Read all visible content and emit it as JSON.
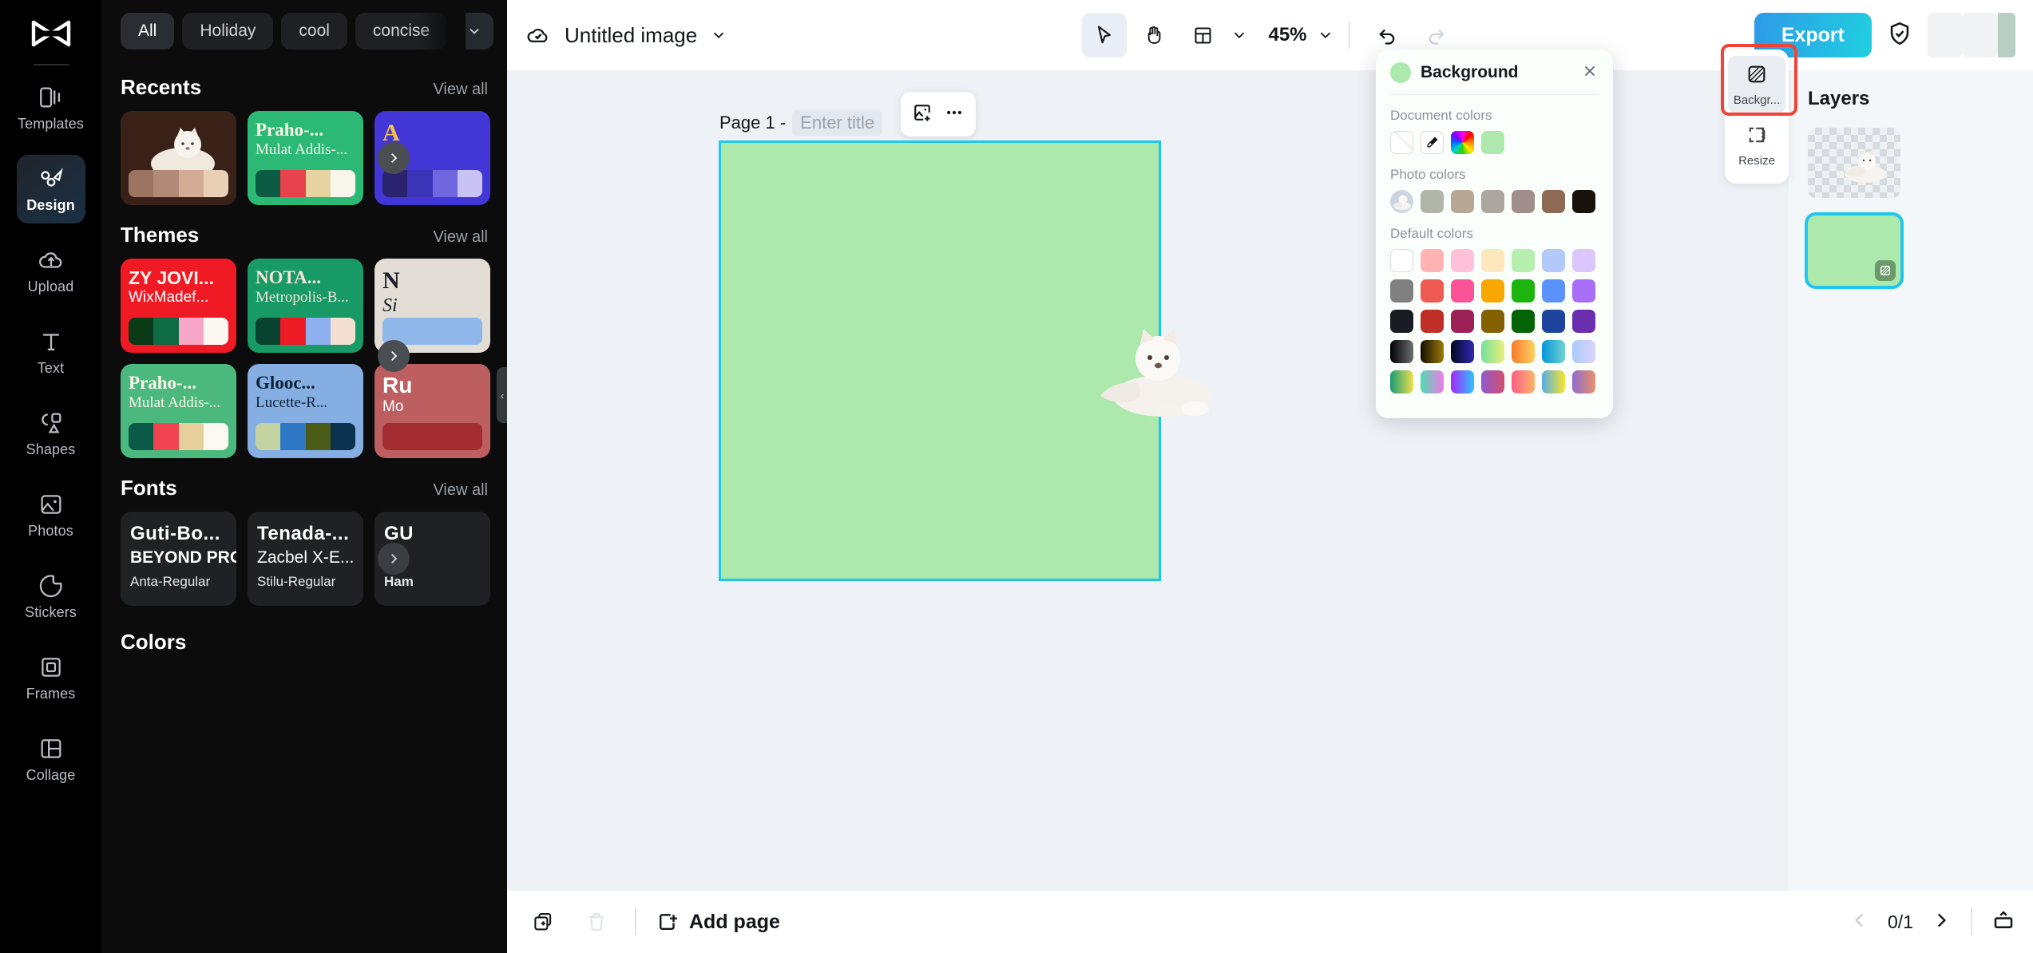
{
  "rail": {
    "logo_icon": "capcut-logo-icon",
    "items": [
      {
        "label": "Templates",
        "icon": "templates-icon",
        "active": false
      },
      {
        "label": "Design",
        "icon": "design-icon",
        "active": true
      },
      {
        "label": "Upload",
        "icon": "upload-cloud-icon",
        "active": false
      },
      {
        "label": "Text",
        "icon": "text-t-icon",
        "active": false
      },
      {
        "label": "Shapes",
        "icon": "shapes-icon",
        "active": false
      },
      {
        "label": "Photos",
        "icon": "photo-icon",
        "active": false
      },
      {
        "label": "Stickers",
        "icon": "sticker-icon",
        "active": false
      },
      {
        "label": "Frames",
        "icon": "frame-icon",
        "active": false
      },
      {
        "label": "Collage",
        "icon": "collage-icon",
        "active": false
      }
    ]
  },
  "panel": {
    "chips": [
      {
        "label": "All",
        "active": true
      },
      {
        "label": "Holiday",
        "active": false
      },
      {
        "label": "cool",
        "active": false
      },
      {
        "label": "concise",
        "active": false
      }
    ],
    "chip_caret_icon": "chevron-down-icon",
    "sections": {
      "recents": {
        "title": "Recents",
        "view_all": "View all"
      },
      "themes": {
        "title": "Themes",
        "view_all": "View all"
      },
      "fonts": {
        "title": "Fonts",
        "view_all": "View all"
      },
      "colors": {
        "title": "Colors"
      }
    },
    "recents": [
      {
        "type": "photo",
        "bg": "#3a2117",
        "swatches": [
          "#9c7462",
          "#b08a76",
          "#d3ac95",
          "#e9cfb5"
        ]
      },
      {
        "type": "theme",
        "bg": "#2cb975",
        "t1": "Praho-...",
        "t2": "Mulat Addis-...",
        "t1color": "#f7f3e8",
        "t2color": "#f7f3e8",
        "swatches": [
          "#0c5c43",
          "#e8434c",
          "#e6d3a0",
          "#f9f6ec"
        ]
      },
      {
        "type": "theme",
        "bg": "#4236d6",
        "t1": "A",
        "t2": "",
        "t1color": "#f4c24a",
        "t2color": "#ffffff",
        "swatches": [
          "#2a2470",
          "#3b33b8",
          "#6f66e0",
          "#c8c3f2"
        ]
      }
    ],
    "themes": [
      {
        "bg": "#f01a24",
        "t1": "ZY JOVI...",
        "t2": "WixMadef...",
        "t1color": "#faf5ee",
        "t2color": "#ffffff",
        "swatches": [
          "#0b3b16",
          "#0f6b43",
          "#f8a6c6",
          "#fbf8f2"
        ]
      },
      {
        "bg": "#179a66",
        "t1": "NOTA...",
        "t2": "Metropolis-B...",
        "t1color": "#f3e4d7",
        "t2color": "#f3e4d7",
        "swatches": [
          "#07432e",
          "#ed1b24",
          "#8fb0ef",
          "#f3e0d2"
        ]
      },
      {
        "bg": "#e2ded6",
        "t1": "N",
        "t2": "Si",
        "t1color": "#1a1e26",
        "t2color": "#1a1e26",
        "swatches": [
          "#8fb7ea",
          "#8fb7ea",
          "#8fb7ea",
          "#8fb7ea"
        ]
      },
      {
        "bg": "#4bb97d",
        "t1": "Praho-...",
        "t2": "Mulat Addis-...",
        "t1color": "#faf6ea",
        "t2color": "#faf6ea",
        "swatches": [
          "#0b5a49",
          "#f04350",
          "#e6cf9b",
          "#fbf9f0"
        ]
      },
      {
        "bg": "#85aee2",
        "t1": "Glooc...",
        "t2": "Lucette-R...",
        "t1color": "#0e2236",
        "t2color": "#0e2236",
        "swatches": [
          "#c3d3a2",
          "#2e77c4",
          "#4b5c18",
          "#0b3350"
        ]
      },
      {
        "bg": "#bd5f60",
        "t1": "Ru",
        "t2": "Mo",
        "t1color": "#ffffff",
        "t2color": "#ffffff",
        "swatches": [
          "#a32d33",
          "#a32d33",
          "#a32d33",
          "#a32d33"
        ]
      }
    ],
    "fonts": [
      {
        "t1": "Guti-Bo...",
        "t2": "BEYOND PRO...",
        "t3": "Anta-Regular"
      },
      {
        "t1": "Tenada-...",
        "t2": "Zacbel X-E...",
        "t3": "Stilu-Regular"
      },
      {
        "t1": "GU",
        "t2": "(",
        "t3": "Ham"
      }
    ],
    "next_icon": "chevron-right-icon",
    "collapse_icon": "collapse-panel-icon"
  },
  "topbar": {
    "cloud_icon": "cloud-saved-icon",
    "doc_name": "Untitled image",
    "doc_caret_icon": "chevron-down-icon",
    "tools": [
      {
        "name": "select-tool",
        "icon": "cursor-arrow-icon",
        "selected": true
      },
      {
        "name": "hand-tool",
        "icon": "hand-icon",
        "selected": false
      },
      {
        "name": "layout-tool",
        "icon": "layout-grid-icon",
        "selected": false
      }
    ],
    "layout_caret_icon": "chevron-down-icon",
    "zoom_value": "45%",
    "zoom_caret_icon": "chevron-down-icon",
    "undo_icon": "undo-icon",
    "redo_icon": "redo-icon",
    "export_label": "Export",
    "shield_icon": "shield-check-icon"
  },
  "canvas": {
    "page_label": "Page 1 -",
    "title_placeholder": "Enter title",
    "float_toolbar": {
      "add_image_icon": "add-image-icon",
      "more_icon": "more-dots-icon"
    },
    "page_bg_color": "#ade8ad",
    "selection_color": "#1fc6ef"
  },
  "background_panel": {
    "title": "Background",
    "swatch_color": "#ade8ad",
    "close_icon": "close-icon",
    "document_colors": {
      "label": "Document colors",
      "items": [
        {
          "name": "transparent-swatch",
          "type": "none"
        },
        {
          "name": "eyedropper-swatch",
          "type": "eyedropper"
        },
        {
          "name": "color-wheel-swatch",
          "type": "wheel"
        },
        {
          "name": "green-swatch",
          "type": "color",
          "color": "#ade8ad"
        }
      ]
    },
    "photo_colors": {
      "label": "Photo colors",
      "items": [
        {
          "name": "photo-thumbnail",
          "type": "photo"
        },
        {
          "color": "#b0b5a8"
        },
        {
          "color": "#b8a795"
        },
        {
          "color": "#aba79f"
        },
        {
          "color": "#a08e8b"
        },
        {
          "color": "#8e6953"
        },
        {
          "color": "#17130a"
        }
      ]
    },
    "default_colors": {
      "label": "Default colors",
      "rows": [
        [
          "#ffffff",
          "#ffb3b3",
          "#ffc0d8",
          "#fde8bd",
          "#b6efae",
          "#b3c9fa",
          "#dcc6fb"
        ],
        [
          "#808080",
          "#ef5b52",
          "#fb5397",
          "#f8a800",
          "#1bb50d",
          "#5c92fb",
          "#a86ef8"
        ],
        [
          "#191b22",
          "#bf2f27",
          "#9c2156",
          "#836100",
          "#046302",
          "#1e449e",
          "#6a2eaf"
        ],
        [
          "linear-gradient(90deg,#000 0%,#6e6e6e 100%)",
          "linear-gradient(90deg,#120d00 0%,#9c7b0a 100%)",
          "linear-gradient(90deg,#05061e 0%,#3027b4 100%)",
          "linear-gradient(90deg,#76e0a0 0%,#e9ef78 100%)",
          "linear-gradient(90deg,#f77a2a 0%,#fbd164 100%)",
          "linear-gradient(90deg,#0497dd 0%,#6fd2cc 100%)",
          "linear-gradient(90deg,#a7cbfb 0%,#ddd3fb 100%)"
        ],
        [
          "linear-gradient(90deg,#179b74 0%,#f1e14f 100%)",
          "linear-gradient(90deg,#4fdcb0 0%,#f07ce8 100%)",
          "linear-gradient(90deg,#a327fb 0%,#2ec3fb 100%)",
          "linear-gradient(90deg,#8f5bd0 0%,#d24e6b 100%)",
          "linear-gradient(90deg,#fb5f86 0%,#fbb469 100%)",
          "linear-gradient(90deg,#56aee6 0%,#f7e42c 100%)",
          "linear-gradient(90deg,#8f6bd0 0%,#e8926a 100%)"
        ]
      ]
    }
  },
  "right_tools": {
    "items": [
      {
        "label": "Backgr...",
        "icon": "background-icon",
        "selected": true,
        "highlighted": true
      },
      {
        "label": "Resize",
        "icon": "resize-icon",
        "selected": false,
        "highlighted": false
      }
    ],
    "highlight_color": "#f04438"
  },
  "layers": {
    "title": "Layers",
    "items": [
      {
        "name": "layer-photo",
        "type": "checker",
        "selected": false
      },
      {
        "name": "layer-background",
        "type": "color",
        "color": "#ade8ad",
        "selected": true,
        "badge_icon": "background-icon"
      }
    ]
  },
  "bottombar": {
    "duplicate_icon": "duplicate-page-icon",
    "delete_icon": "trash-icon",
    "add_page_icon": "add-page-icon",
    "add_page_label": "Add page",
    "prev_icon": "chevron-left-icon",
    "page_counter": "0/1",
    "next_icon": "chevron-right-icon",
    "present_icon": "present-icon"
  }
}
